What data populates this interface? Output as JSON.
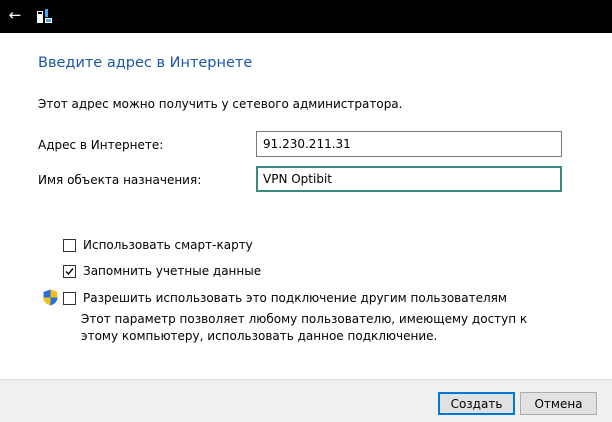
{
  "titlebar": {
    "back_icon": "back-arrow-icon",
    "app_icon": "network-icon"
  },
  "dialog": {
    "heading": "Введите адрес в Интернете",
    "description": "Этот адрес можно получить у сетевого администратора.",
    "fields": {
      "address": {
        "label": "Адрес в Интернете:",
        "value": "91.230.211.31"
      },
      "destination": {
        "label": "Имя объекта назначения:",
        "value": "VPN Optibit"
      }
    },
    "options": {
      "smartcard": {
        "label": "Использовать смарт-карту",
        "checked": false
      },
      "remember": {
        "label": "Запомнить учетные данные",
        "checked": true
      },
      "share": {
        "label": "Разрешить использовать это подключение другим пользователям",
        "checked": false,
        "icon": "uac-shield-icon"
      }
    },
    "share_hint": "Этот параметр позволяет любому пользователю, имеющему доступ к этому компьютеру, использовать данное подключение."
  },
  "footer": {
    "create_label": "Создать",
    "cancel_label": "Отмена"
  },
  "colors": {
    "heading": "#1b57a8",
    "focus_border": "#3b8a7f",
    "default_button_border": "#0078d7",
    "footer_bg": "#f0f0f0"
  }
}
